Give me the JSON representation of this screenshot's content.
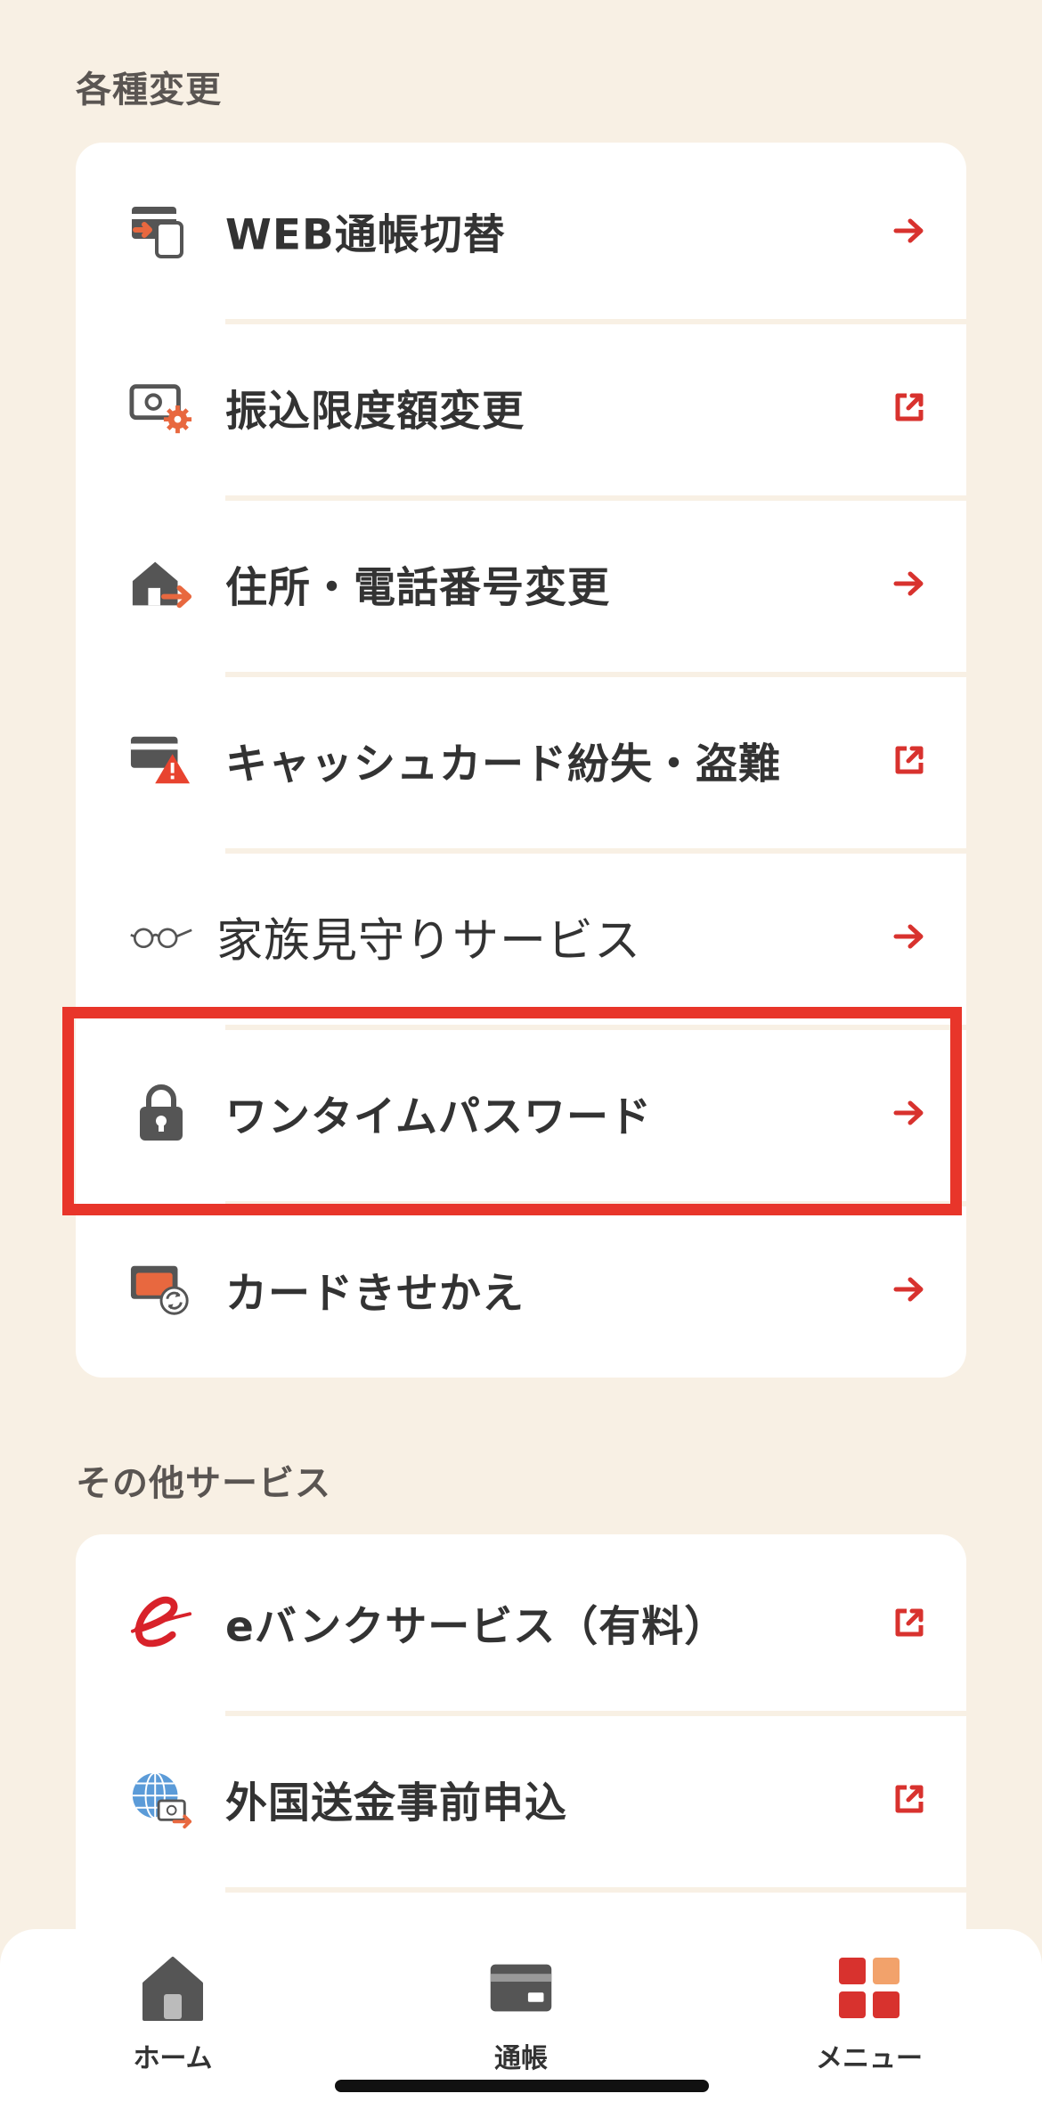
{
  "sections": {
    "changes": {
      "title": "各種変更",
      "items": [
        {
          "label": "WEB通帳切替",
          "icon": "passbook-switch-icon",
          "action": "arrow"
        },
        {
          "label": "振込限度額変更",
          "icon": "limit-settings-icon",
          "action": "external"
        },
        {
          "label": "住所・電話番号変更",
          "icon": "house-move-icon",
          "action": "arrow"
        },
        {
          "label": "キャッシュカード紛失・盗難",
          "icon": "card-warning-icon",
          "action": "external"
        },
        {
          "label": "家族見守りサービス",
          "icon": "glasses-icon",
          "action": "arrow"
        },
        {
          "label": "ワンタイムパスワード",
          "icon": "lock-icon",
          "action": "arrow"
        },
        {
          "label": "カードきせかえ",
          "icon": "card-change-icon",
          "action": "arrow"
        }
      ]
    },
    "other": {
      "title": "その他サービス",
      "items": [
        {
          "label": "eバンクサービス（有料）",
          "icon": "e-logo-icon",
          "action": "external"
        },
        {
          "label": "外国送金事前申込",
          "icon": "globe-remit-icon",
          "action": "external"
        }
      ]
    }
  },
  "tabbar": {
    "home": "ホーム",
    "passbook": "通帳",
    "menu": "メニュー"
  },
  "colors": {
    "background": "#F8F0E4",
    "accent": "#D8322E",
    "highlight": "#E8352A",
    "icon_dark": "#555555",
    "icon_orange": "#E8683F"
  }
}
